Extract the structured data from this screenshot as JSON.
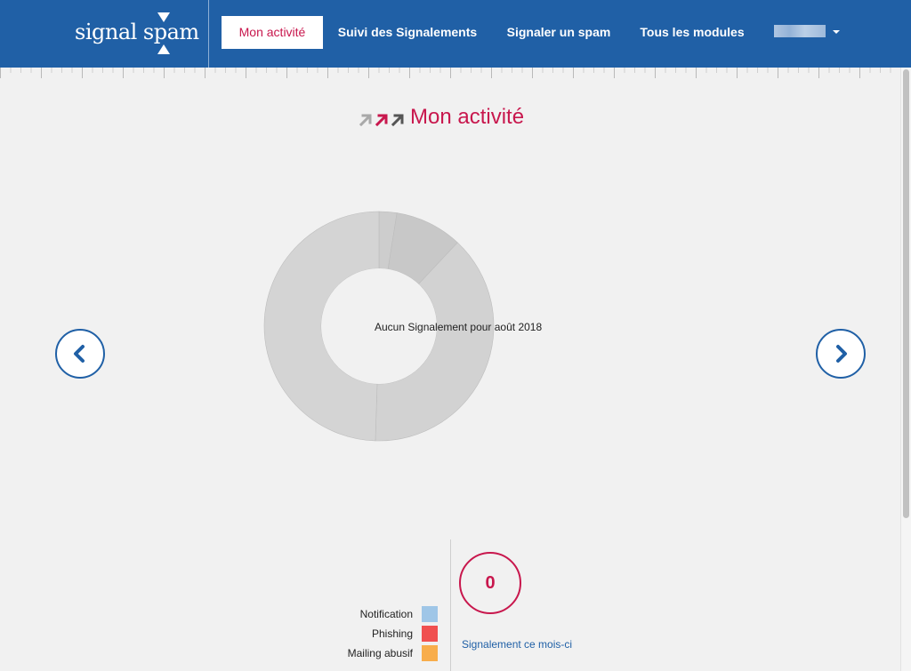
{
  "header": {
    "logo_text": "signal spam",
    "nav": [
      {
        "label": "Mon activité",
        "active": true
      },
      {
        "label": "Suivi des Signalements",
        "active": false
      },
      {
        "label": "Signaler un spam",
        "active": false
      },
      {
        "label": "Tous les modules",
        "active": false
      }
    ],
    "user_menu_icon": "chevron-down-icon"
  },
  "main": {
    "title": "Mon activité",
    "title_icon": "triple-arrow-icon",
    "empty_message": "Aucun Signalement pour août 2018",
    "prev_icon": "chevron-left-icon",
    "next_icon": "chevron-right-icon"
  },
  "chart_data": {
    "type": "pie",
    "style": "donut",
    "state": "empty placeholder (all segments grey)",
    "slices_fraction": [
      0.025,
      0.095,
      0.385,
      0.495
    ]
  },
  "legend": {
    "items": [
      {
        "label": "Notification",
        "color": "#9fc6e7"
      },
      {
        "label": "Phishing",
        "color": "#f05050"
      },
      {
        "label": "Mailing abusif",
        "color": "#f8ad4b"
      }
    ]
  },
  "stats": {
    "count": "0",
    "label": "Signalement ce mois-ci"
  },
  "colors": {
    "brand_blue": "#2060a6",
    "accent_red": "#c8174d",
    "background": "#f1f1f1",
    "donut_grey": "#d4d4d4"
  }
}
